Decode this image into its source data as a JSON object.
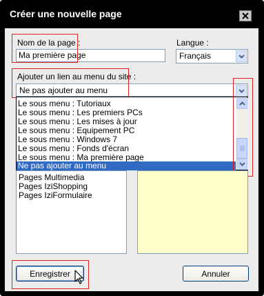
{
  "dialog": {
    "title": "Créer une nouvelle page",
    "close_icon": "close-icon"
  },
  "page_name": {
    "label": "Nom de la page :",
    "value": "Ma première page"
  },
  "language": {
    "label": "Langue :",
    "value": "Français"
  },
  "menu_link": {
    "label": "Ajouter un lien au menu du site :",
    "value": "Ne pas ajouter au menu",
    "options": [
      "Le sous menu : Tutoriaux",
      "Le sous menu : Les premiers PCs",
      "Le sous menu : Les mises à jour",
      "Le sous menu : Equipement PC",
      "Le sous menu : Windows 7",
      "Le sous menu : Fonds d'écran",
      "Le sous menu : Ma première page",
      "Ne pas ajouter au menu"
    ],
    "selected_option": "Ne pas ajouter au menu"
  },
  "templates": {
    "items": [
      "Pages Multimedia",
      "Pages IziShopping",
      "Pages IziFormulaire"
    ]
  },
  "buttons": {
    "save": "Enregistrer",
    "cancel": "Annuler"
  },
  "colors": {
    "highlight": "#e02020",
    "selection": "#316ac5",
    "preview_bg": "#ffffcc"
  }
}
